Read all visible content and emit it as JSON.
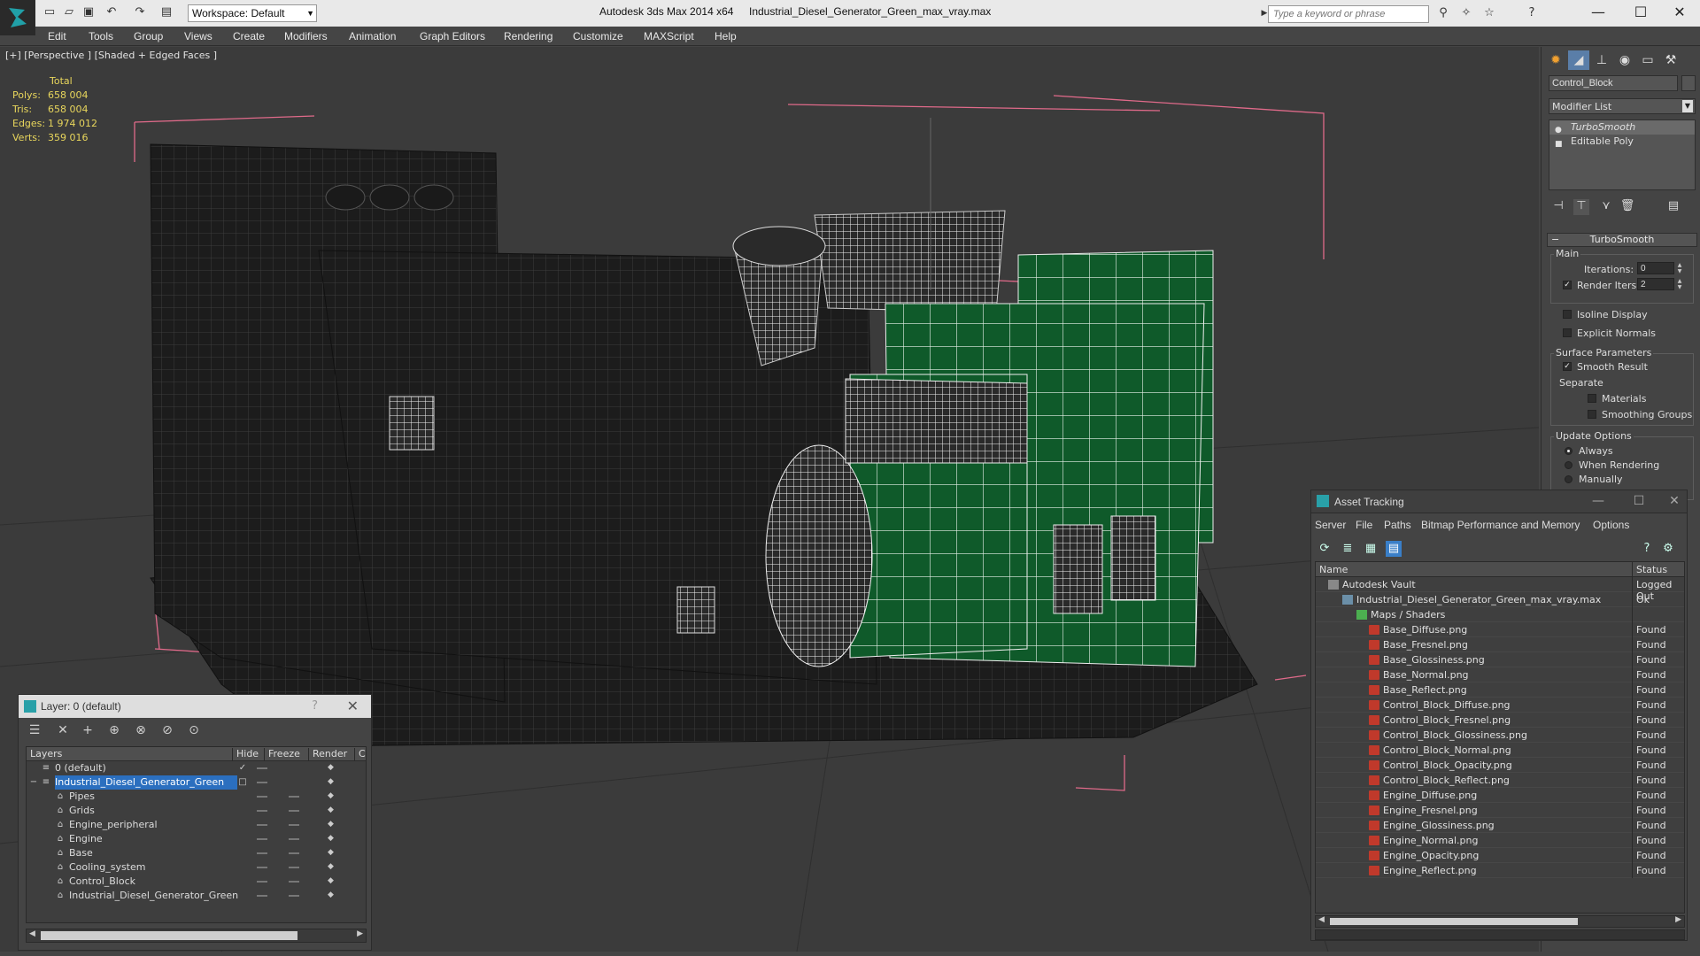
{
  "titlebar": {
    "workspace_label": "Workspace: Default",
    "app_title": "Autodesk 3ds Max  2014 x64",
    "file_title": "Industrial_Diesel_Generator_Green_max_vray.max",
    "search_placeholder": "Type a keyword or phrase",
    "minimize": "—",
    "maximize": "☐",
    "close": "✕"
  },
  "menubar": {
    "items": [
      "Edit",
      "Tools",
      "Group",
      "Views",
      "Create",
      "Modifiers",
      "Animation",
      "Graph Editors",
      "Rendering",
      "Customize",
      "MAXScript",
      "Help"
    ]
  },
  "viewport": {
    "label": "[+] [Perspective ] [Shaded + Edged Faces ]",
    "stats": {
      "header": "Total",
      "polys_label": "Polys:",
      "polys": "658 004",
      "tris_label": "Tris:",
      "tris": "658 004",
      "edges_label": "Edges:",
      "edges": "1 974 012",
      "verts_label": "Verts:",
      "verts": "359 016"
    }
  },
  "layer_panel": {
    "title": "Layer: 0 (default)",
    "help": "?",
    "close": "✕",
    "columns": [
      "Layers",
      "Hide",
      "Freeze",
      "Render",
      "C"
    ],
    "rows": [
      {
        "name": "0 (default)",
        "level": 1
      },
      {
        "name": "Industrial_Diesel_Generator_Green",
        "level": 1
      },
      {
        "name": "Pipes",
        "level": 2
      },
      {
        "name": "Grids",
        "level": 2
      },
      {
        "name": "Engine_peripheral",
        "level": 2
      },
      {
        "name": "Engine",
        "level": 2
      },
      {
        "name": "Base",
        "level": 2
      },
      {
        "name": "Cooling_system",
        "level": 2
      },
      {
        "name": "Control_Block",
        "level": 2
      },
      {
        "name": "Industrial_Diesel_Generator_Green",
        "level": 2
      }
    ]
  },
  "command_panel": {
    "object_name": "Control_Block",
    "modifier_list": "Modifier List",
    "stack": [
      "TurboSmooth",
      "Editable Poly"
    ],
    "rollout_title": "TurboSmooth",
    "main_group": "Main",
    "iterations_label": "Iterations:",
    "iterations_value": "0",
    "render_iters_label": "Render Iters:",
    "render_iters_value": "2",
    "isoline_label": "Isoline Display",
    "explicit_normals_label": "Explicit Normals",
    "surface_group": "Surface Parameters",
    "smooth_result_label": "Smooth Result",
    "separate_label": "Separate",
    "materials_label": "Materials",
    "smoothing_groups_label": "Smoothing Groups",
    "update_group": "Update Options",
    "always_label": "Always",
    "when_rendering_label": "When Rendering",
    "manually_label": "Manually"
  },
  "asset_tracking": {
    "title": "Asset Tracking",
    "menu": [
      "Server",
      "File",
      "Paths",
      "Bitmap Performance and Memory",
      "Options"
    ],
    "col_name": "Name",
    "col_status": "Status",
    "rows": [
      {
        "name": "Autodesk Vault",
        "status": "Logged Out",
        "type": "vault",
        "level": 0
      },
      {
        "name": "Industrial_Diesel_Generator_Green_max_vray.max",
        "status": "Ok",
        "type": "max",
        "level": 1
      },
      {
        "name": "Maps / Shaders",
        "status": "",
        "type": "maps",
        "level": 2
      },
      {
        "name": "Base_Diffuse.png",
        "status": "Found",
        "type": "png",
        "level": 3
      },
      {
        "name": "Base_Fresnel.png",
        "status": "Found",
        "type": "png",
        "level": 3
      },
      {
        "name": "Base_Glossiness.png",
        "status": "Found",
        "type": "png",
        "level": 3
      },
      {
        "name": "Base_Normal.png",
        "status": "Found",
        "type": "png",
        "level": 3
      },
      {
        "name": "Base_Reflect.png",
        "status": "Found",
        "type": "png",
        "level": 3
      },
      {
        "name": "Control_Block_Diffuse.png",
        "status": "Found",
        "type": "png",
        "level": 3
      },
      {
        "name": "Control_Block_Fresnel.png",
        "status": "Found",
        "type": "png",
        "level": 3
      },
      {
        "name": "Control_Block_Glossiness.png",
        "status": "Found",
        "type": "png",
        "level": 3
      },
      {
        "name": "Control_Block_Normal.png",
        "status": "Found",
        "type": "png",
        "level": 3
      },
      {
        "name": "Control_Block_Opacity.png",
        "status": "Found",
        "type": "png",
        "level": 3
      },
      {
        "name": "Control_Block_Reflect.png",
        "status": "Found",
        "type": "png",
        "level": 3
      },
      {
        "name": "Engine_Diffuse.png",
        "status": "Found",
        "type": "png",
        "level": 3
      },
      {
        "name": "Engine_Fresnel.png",
        "status": "Found",
        "type": "png",
        "level": 3
      },
      {
        "name": "Engine_Glossiness.png",
        "status": "Found",
        "type": "png",
        "level": 3
      },
      {
        "name": "Engine_Normal.png",
        "status": "Found",
        "type": "png",
        "level": 3
      },
      {
        "name": "Engine_Opacity.png",
        "status": "Found",
        "type": "png",
        "level": 3
      },
      {
        "name": "Engine_Reflect.png",
        "status": "Found",
        "type": "png",
        "level": 3
      }
    ]
  },
  "colors": {
    "stats": "#e8d65c",
    "generator_green": "#0f5a2a",
    "selection_blue": "#2b6fbf",
    "bounding_box": "#e06a8a"
  }
}
